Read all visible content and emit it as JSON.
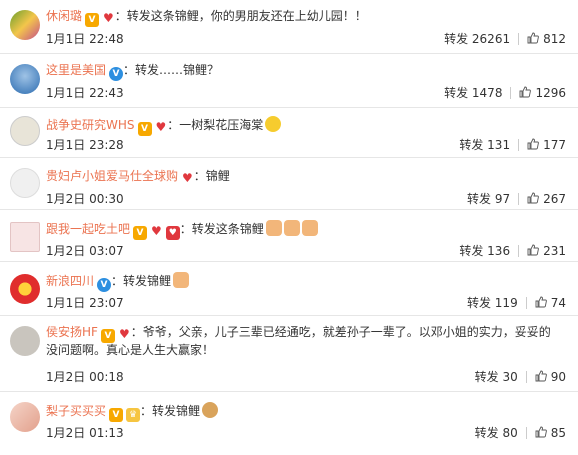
{
  "comments": [
    {
      "name": "休闲璐",
      "text": "：转发这条锦鲤，你的男朋友还在上幼儿园！！",
      "date": "1月1日 22:48",
      "repost": "转发 26261",
      "likes": "812"
    },
    {
      "name": "这里是美国",
      "text": "：转发……锦鲤？",
      "date": "1月1日 22:43",
      "repost": "转发 1478",
      "likes": "1296"
    },
    {
      "name": "战争史研究WHS",
      "text": "：一树梨花压海棠",
      "date": "1月1日 23:28",
      "repost": "转发 131",
      "likes": "177"
    },
    {
      "name": "贵妇卢小姐爱马仕全球购",
      "text": "：锦鲤",
      "date": "1月2日 00:30",
      "repost": "转发 97",
      "likes": "267"
    },
    {
      "name": "跟我一起吃土吧",
      "text": "：转发这条锦鲤",
      "date": "1月2日 03:07",
      "repost": "转发 136",
      "likes": "231"
    },
    {
      "name": "新浪四川",
      "text": "：转发锦鲤",
      "date": "1月1日 23:07",
      "repost": "转发 119",
      "likes": "74"
    },
    {
      "name": "侯安扬HF",
      "text": "：爷爷，父亲，儿子三辈已经通吃，就差孙子一辈了。以邓小姐的实力，妥妥的",
      "text2": "没问题啊。真心是人生大赢家！",
      "date": "1月2日 00:18",
      "repost": "转发 30",
      "likes": "90"
    },
    {
      "name": "梨子买买买",
      "text": "：转发锦鲤",
      "date": "1月2日 01:13",
      "repost": "转发 80",
      "likes": "85"
    }
  ],
  "icons": {
    "like": "thumb-up-icon",
    "vip": "v-badge-icon",
    "heart": "heart-badge-icon"
  }
}
